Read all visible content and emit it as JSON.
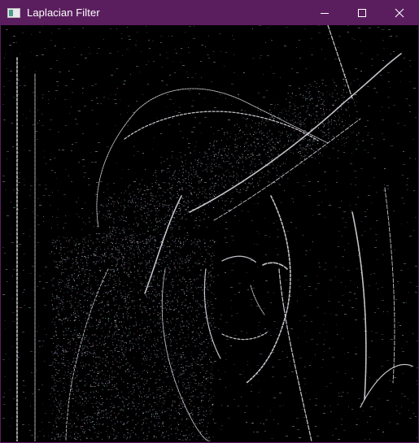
{
  "window": {
    "title": "Laplacian Filter",
    "titlebar_color": "#5a1e5e",
    "app_icon": "app-window-icon"
  },
  "caption_buttons": [
    {
      "name": "minimize-button",
      "icon": "minimize-icon"
    },
    {
      "name": "maximize-button",
      "icon": "maximize-icon"
    },
    {
      "name": "close-button",
      "icon": "close-icon"
    }
  ],
  "image": {
    "description_tag": "laplacian-edge-output",
    "background_color": "#000000",
    "edge_color": "#e8e8f0"
  }
}
